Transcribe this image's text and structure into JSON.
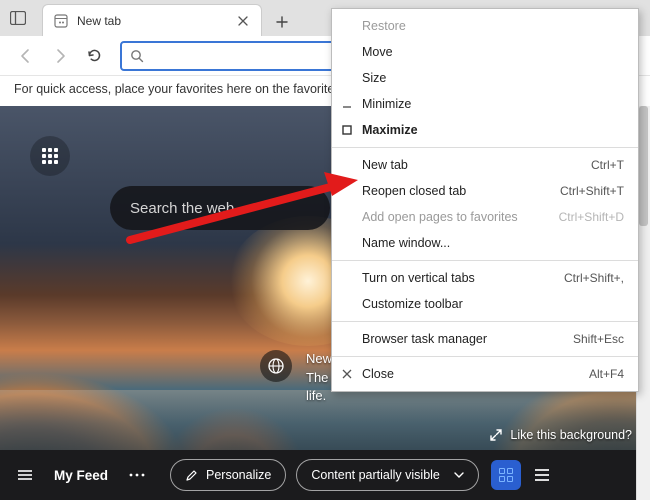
{
  "tab": {
    "title": "New tab"
  },
  "toolbar": {
    "search_value": ""
  },
  "infostrip": {
    "text": "For quick access, place your favorites here on the favorites"
  },
  "context_menu": {
    "items": [
      {
        "label": "Restore",
        "shortcut": "",
        "icon": "",
        "disabled": true,
        "bold": false,
        "sep_after": false
      },
      {
        "label": "Move",
        "shortcut": "",
        "icon": "",
        "disabled": false,
        "bold": false,
        "sep_after": false
      },
      {
        "label": "Size",
        "shortcut": "",
        "icon": "",
        "disabled": false,
        "bold": false,
        "sep_after": false
      },
      {
        "label": "Minimize",
        "shortcut": "",
        "icon": "minimize",
        "disabled": false,
        "bold": false,
        "sep_after": false
      },
      {
        "label": "Maximize",
        "shortcut": "",
        "icon": "maximize",
        "disabled": false,
        "bold": true,
        "sep_after": true
      },
      {
        "label": "New tab",
        "shortcut": "Ctrl+T",
        "icon": "",
        "disabled": false,
        "bold": false,
        "sep_after": false
      },
      {
        "label": "Reopen closed tab",
        "shortcut": "Ctrl+Shift+T",
        "icon": "",
        "disabled": false,
        "bold": false,
        "sep_after": false
      },
      {
        "label": "Add open pages to favorites",
        "shortcut": "Ctrl+Shift+D",
        "icon": "",
        "disabled": true,
        "bold": false,
        "sep_after": false
      },
      {
        "label": "Name window...",
        "shortcut": "",
        "icon": "",
        "disabled": false,
        "bold": false,
        "sep_after": true
      },
      {
        "label": "Turn on vertical tabs",
        "shortcut": "Ctrl+Shift+,",
        "icon": "",
        "disabled": false,
        "bold": false,
        "sep_after": false
      },
      {
        "label": "Customize toolbar",
        "shortcut": "",
        "icon": "",
        "disabled": false,
        "bold": false,
        "sep_after": true
      },
      {
        "label": "Browser task manager",
        "shortcut": "Shift+Esc",
        "icon": "",
        "disabled": false,
        "bold": false,
        "sep_after": true
      },
      {
        "label": "Close",
        "shortcut": "Alt+F4",
        "icon": "close",
        "disabled": false,
        "bold": false,
        "sep_after": false
      }
    ]
  },
  "ntp": {
    "search_placeholder": "Search the web",
    "promo_text": "New from Surface—laptops designed by Microsoft. The perfect balance of performance and long battery life.",
    "bg_like": "Like this background?"
  },
  "bottombar": {
    "feed": "My Feed",
    "personalize": "Personalize",
    "content_dropdown": "Content partially visible"
  }
}
